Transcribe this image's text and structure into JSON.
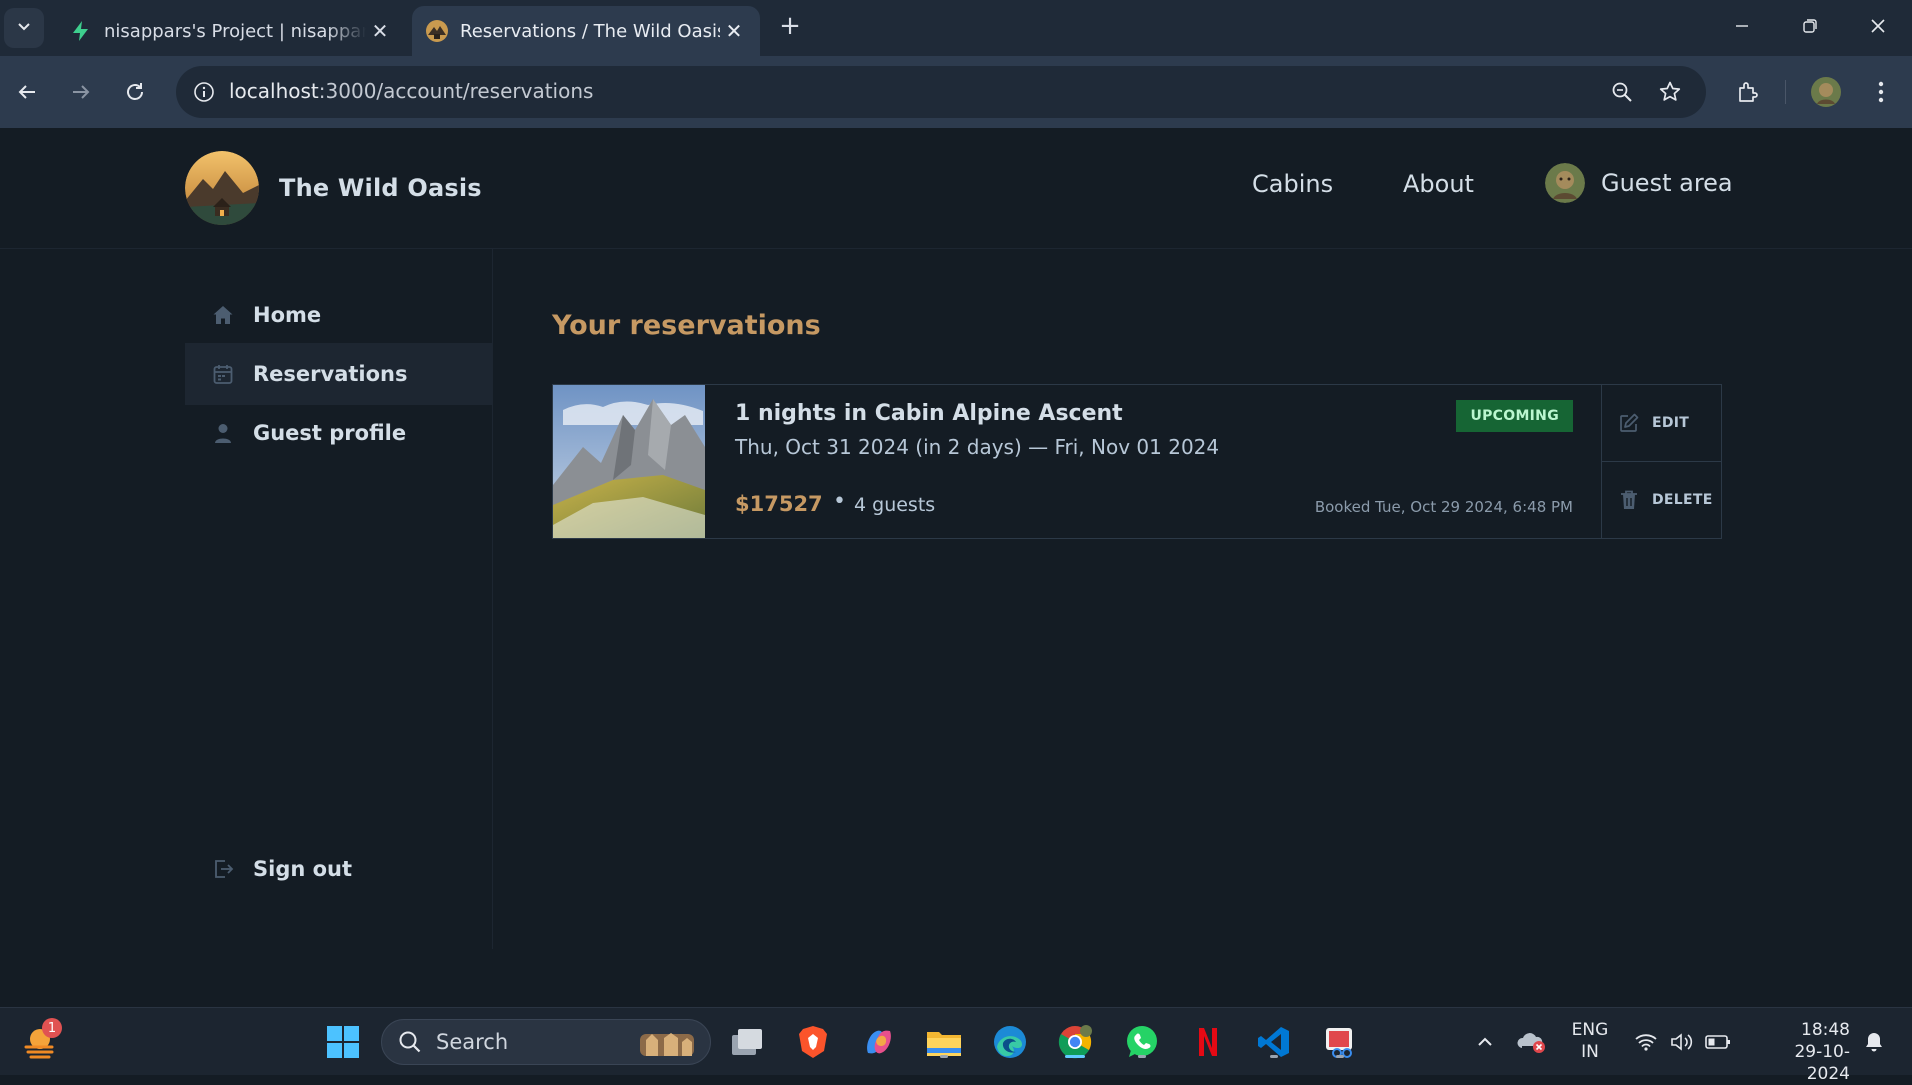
{
  "browser": {
    "tabs": [
      {
        "title": "nisappars's Project | nisappars's",
        "close": "✕"
      },
      {
        "title": "Reservations / The Wild Oasis",
        "close": "✕"
      }
    ],
    "new_tab": "+",
    "url_host": "localhost",
    "url_path": ":3000/account/reservations"
  },
  "site": {
    "brand": "The Wild Oasis",
    "nav": {
      "cabins": "Cabins",
      "about": "About",
      "guest_area": "Guest area"
    },
    "sidebar": {
      "items": [
        {
          "label": "Home",
          "icon": "home-icon"
        },
        {
          "label": "Reservations",
          "icon": "calendar-icon",
          "active": true
        },
        {
          "label": "Guest profile",
          "icon": "user-icon"
        }
      ],
      "sign_out": "Sign out"
    },
    "page_title": "Your reservations",
    "reservation": {
      "title": "1 nights in Cabin Alpine Ascent",
      "dates": "Thu, Oct 31 2024 (in 2 days) — Fri, Nov 01 2024",
      "price": "$17527",
      "separator": "•",
      "guests": "4 guests",
      "status": "UPCOMING",
      "booked": "Booked Tue, Oct 29 2024, 6:48 PM",
      "edit": "EDIT",
      "delete": "DELETE"
    },
    "colors": {
      "accent": "#c69963",
      "background": "#141c24",
      "badge": "#166534"
    }
  },
  "taskbar": {
    "search_placeholder": "Search",
    "notification_count": "1",
    "language": "ENG",
    "region": "IN",
    "time": "18:48",
    "date": "29-10-2024"
  }
}
